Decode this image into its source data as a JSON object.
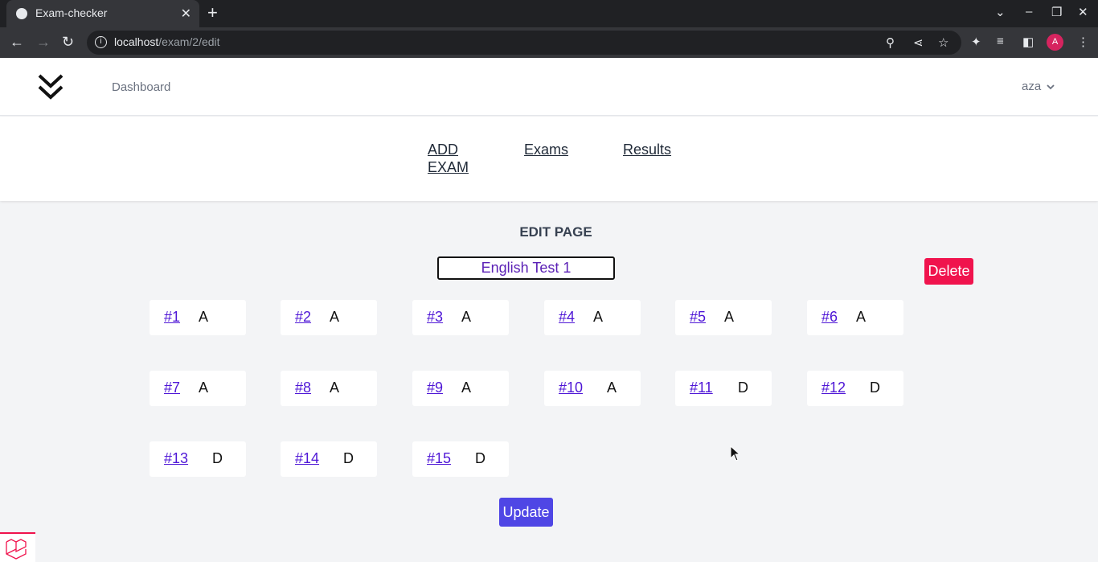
{
  "browser": {
    "tab_title": "Exam-checker",
    "url_host": "localhost",
    "url_path": "/exam/2/edit",
    "profile_initial": "A",
    "new_tab": "+",
    "tab_close": "✕",
    "icons": [
      "globe-icon",
      "back-icon",
      "forward-icon",
      "reload-icon",
      "info-icon",
      "zoom-icon",
      "share-icon",
      "star-icon",
      "extensions-icon",
      "media-icon",
      "sidepanel-icon",
      "menu-icon"
    ]
  },
  "nav": {
    "dashboard": "Dashboard",
    "user": "aza"
  },
  "subnav": {
    "add_exam_line1": "ADD",
    "add_exam_line2": "EXAM",
    "exams": "Exams",
    "results": "Results"
  },
  "page": {
    "title": "EDIT PAGE",
    "exam_name": "English Test 1",
    "delete_label": "Delete",
    "update_label": "Update"
  },
  "questions": [
    {
      "num": "#1",
      "answer": "A"
    },
    {
      "num": "#2",
      "answer": "A"
    },
    {
      "num": "#3",
      "answer": "A"
    },
    {
      "num": "#4",
      "answer": "A"
    },
    {
      "num": "#5",
      "answer": "A"
    },
    {
      "num": "#6",
      "answer": "A"
    },
    {
      "num": "#7",
      "answer": "A"
    },
    {
      "num": "#8",
      "answer": "A"
    },
    {
      "num": "#9",
      "answer": "A"
    },
    {
      "num": "#10",
      "answer": "A"
    },
    {
      "num": "#11",
      "answer": "D"
    },
    {
      "num": "#12",
      "answer": "D"
    },
    {
      "num": "#13",
      "answer": "D"
    },
    {
      "num": "#14",
      "answer": "D"
    },
    {
      "num": "#15",
      "answer": "D"
    }
  ],
  "colors": {
    "delete": "#f0134d",
    "update": "#4f46e5",
    "link": "#4f17d6"
  }
}
